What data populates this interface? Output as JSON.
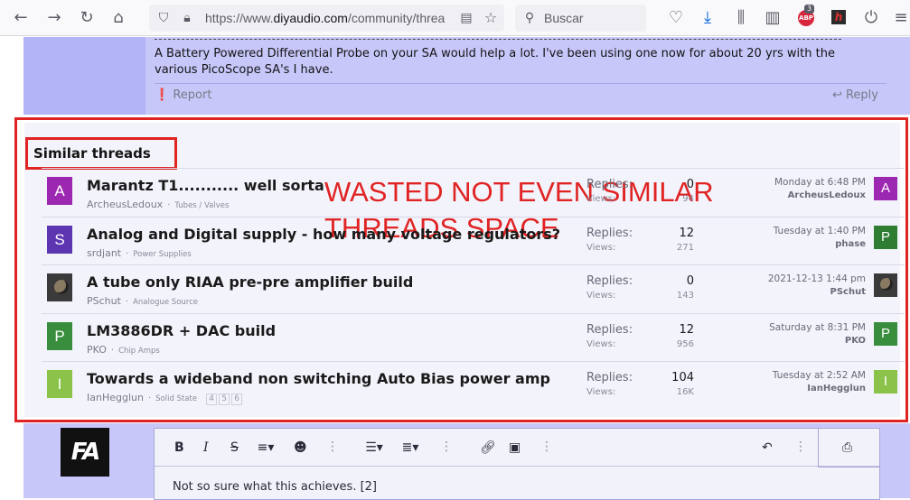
{
  "browser": {
    "url_prefix": "https://www.",
    "url_host": "diyaudio.com",
    "url_path": "/community/threa",
    "search_placeholder": "Buscar",
    "abp_label": "ABP",
    "abp_badge": "3",
    "h_label": "h"
  },
  "post": {
    "divider": "--------------------------------------------------------------------------------------------",
    "text": "A Battery Powered Differential Probe on your SA would help a lot. I've been using one now for about 20 yrs with the various PicoScope SA's I have.",
    "report_label": "Report",
    "reply_label": "Reply"
  },
  "similar": {
    "title": "Similar threads",
    "annotation_line1": "WASTED NOT EVEN SIMILAR",
    "annotation_line2": "THREADS SPACE",
    "replies_label": "Replies:",
    "views_label": "Views:",
    "threads": [
      {
        "avatar": "A",
        "avatar_color": "#9c27b0",
        "title": "Marantz T1........... well sorta",
        "author": "ArcheusLedoux",
        "forum": "Tubes / Valves",
        "replies": "0",
        "views": "94",
        "last_date": "Monday at 6:48 PM",
        "last_user": "ArcheusLedoux",
        "last_avatar": "A",
        "last_color": "#9c27b0",
        "photo": false
      },
      {
        "avatar": "S",
        "avatar_color": "#5e35b1",
        "title": "Analog and Digital supply - how many voltage regulators?",
        "author": "srdjant",
        "forum": "Power Supplies",
        "replies": "12",
        "views": "271",
        "last_date": "Tuesday at 1:40 PM",
        "last_user": "phase",
        "last_avatar": "P",
        "last_color": "#2e7d32",
        "photo": false
      },
      {
        "avatar": "",
        "avatar_color": "#3a3a3a",
        "title": "A tube only RIAA pre-pre amplifier build",
        "author": "PSchut",
        "forum": "Analogue Source",
        "replies": "0",
        "views": "143",
        "last_date": "2021-12-13 1:44 pm",
        "last_user": "PSchut",
        "last_avatar": "",
        "last_color": "#3a3a3a",
        "photo": true
      },
      {
        "avatar": "P",
        "avatar_color": "#388e3c",
        "title": "LM3886DR + DAC build",
        "author": "PKO",
        "forum": "Chip Amps",
        "replies": "12",
        "views": "956",
        "last_date": "Saturday at 8:31 PM",
        "last_user": "PKO",
        "last_avatar": "P",
        "last_color": "#388e3c",
        "photo": false
      },
      {
        "avatar": "I",
        "avatar_color": "#8bc34a",
        "title": "Towards a wideband non switching Auto Bias power amp",
        "author": "IanHegglun",
        "forum": "Solid State",
        "replies": "104",
        "views": "16K",
        "last_date": "Tuesday at 2:52 AM",
        "last_user": "IanHegglun",
        "last_avatar": "I",
        "last_color": "#8bc34a",
        "photo": false,
        "pages": [
          "4",
          "5",
          "6"
        ]
      }
    ]
  },
  "editor": {
    "logo_text": "FA",
    "content": "Not so sure what this achieves. [2]"
  }
}
